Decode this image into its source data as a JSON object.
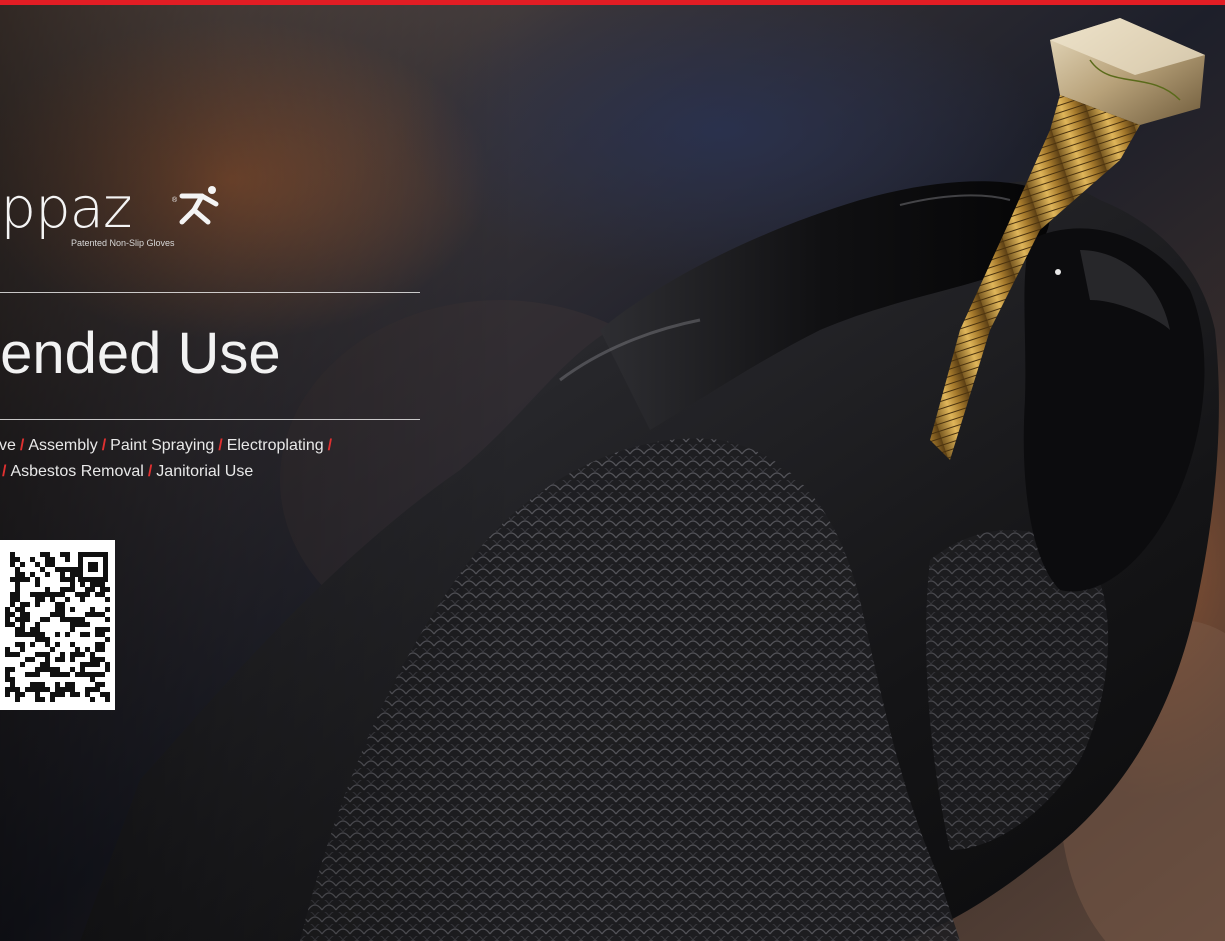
{
  "brand": {
    "logo_text": "ippaz",
    "tagline": "Patented Non-Slip Gloves",
    "figure_icon": "running-figure-icon"
  },
  "section": {
    "title": "tended Use"
  },
  "uses": {
    "line1": [
      "ve",
      "Assembly",
      "Paint Spraying",
      "Electroplating",
      ""
    ],
    "line2": [
      "",
      "Asbestos Removal",
      "Janitorial Use"
    ],
    "separator": "/"
  },
  "qr_code": {
    "icon": "qr-code-icon"
  },
  "colors": {
    "accent_red": "#e21d24",
    "text_white": "#f2f2f2",
    "glove_black": "#0e0e10",
    "bolt_gold": "#c8962f"
  }
}
